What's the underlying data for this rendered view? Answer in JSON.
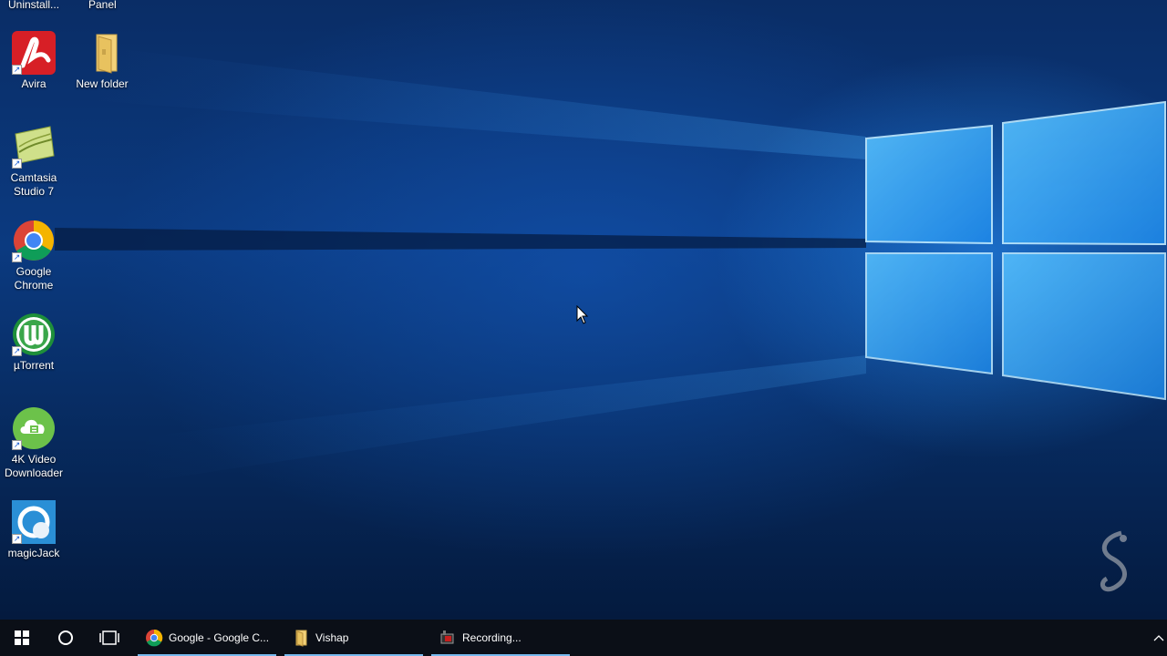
{
  "desktop": {
    "icons_top_cut": [
      {
        "label": "Uninstall..."
      },
      {
        "label": "Panel"
      }
    ],
    "icons": [
      {
        "label_lines": [
          "Avira"
        ]
      },
      {
        "label_lines": [
          "New folder"
        ]
      },
      {
        "label_lines": [
          "Camtasia",
          "Studio 7"
        ]
      },
      {
        "label_lines": [
          "Google",
          "Chrome"
        ]
      },
      {
        "label_lines": [
          "µTorrent"
        ]
      },
      {
        "label_lines": [
          "4K Video",
          "Downloader"
        ]
      },
      {
        "label_lines": [
          "magicJack"
        ]
      }
    ]
  },
  "taskbar": {
    "apps": [
      {
        "label": "Google - Google C...",
        "icon": "chrome-icon"
      },
      {
        "label": "Vishap",
        "icon": "folder-icon"
      },
      {
        "label": "Recording...",
        "icon": "camtasia-recorder-icon"
      }
    ]
  },
  "colors": {
    "accent": "#76b9ed",
    "taskbar": "#0b0f17",
    "wallpaper_blue": "#0b3a80"
  }
}
